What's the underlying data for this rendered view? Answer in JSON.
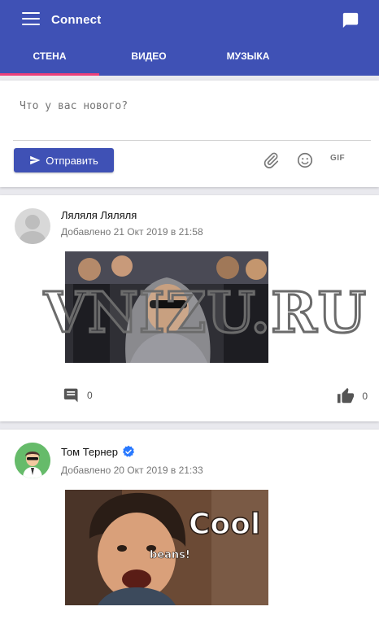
{
  "app": {
    "title": "Connect"
  },
  "tabs": [
    {
      "label": "СТЕНА",
      "active": true
    },
    {
      "label": "ВИДЕО",
      "active": false
    },
    {
      "label": "МУЗЫКА",
      "active": false
    }
  ],
  "composer": {
    "placeholder": "Что у вас нового?",
    "send_label": "Отправить",
    "gif_label": "GIF"
  },
  "posts": [
    {
      "author": "Ляляля Ляляля",
      "verified": false,
      "date": "Добавлено 21 Окт 2019 в 21:58",
      "comments": "0",
      "likes": "0",
      "media_desc": "animated gif"
    },
    {
      "author": "Том Тернер",
      "verified": true,
      "date": "Добавлено 20 Окт 2019 в 21:33",
      "media_text_big": "Cool",
      "media_text_small": "beans!"
    }
  ],
  "watermark": "VNIZU.RU",
  "colors": {
    "primary": "#3f51b5",
    "accent": "#ec407a",
    "verified": "#2979ff"
  }
}
